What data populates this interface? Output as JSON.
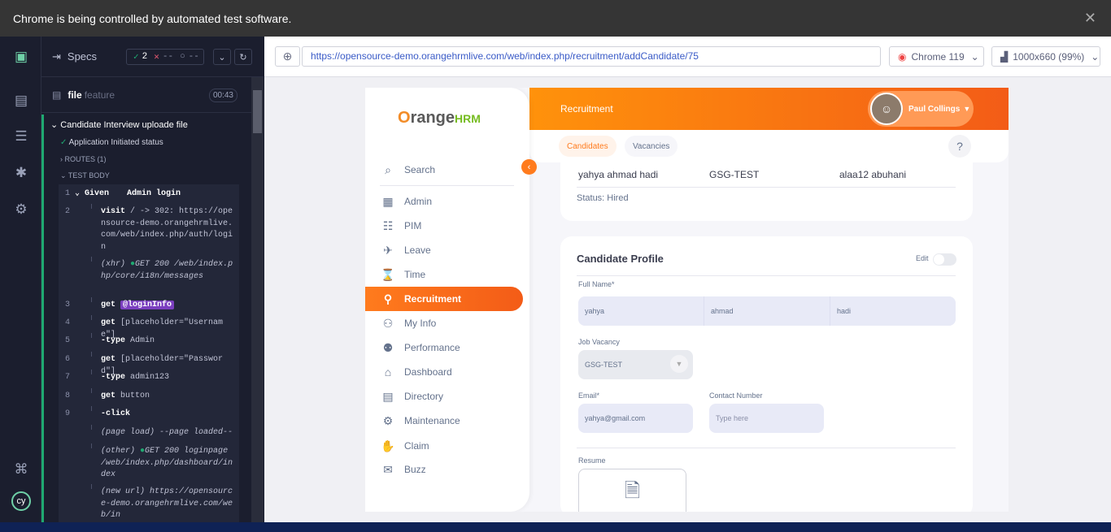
{
  "banner": {
    "text": "Chrome is being controlled by automated test software.",
    "close": "✕"
  },
  "runner": {
    "specs_label": "Specs",
    "passed": "2",
    "failed": "--",
    "pending": "--",
    "file_name": "file",
    "file_ext": "feature",
    "duration": "00:43",
    "suite": "Candidate Interview uploade file",
    "test1": "Application Initiated status",
    "routes": "ROUTES (1)",
    "test_body": "TEST BODY",
    "commands": [
      {
        "n": "1",
        "kw": "Given",
        "arg": "Admin login"
      },
      {
        "n": "2",
        "kw": "visit",
        "arg": "/ -> 302: https://opensource-demo.orangehrmlive.com/web/index.php/auth/login"
      },
      {
        "n": "",
        "kw": "(xhr)",
        "arg": "GET 200 /web/index.php/core/i18n/messages"
      },
      {
        "n": "3",
        "kw": "get",
        "arg": "@loginInfo"
      },
      {
        "n": "4",
        "kw": "get",
        "arg": "[placeholder=\"Username\"]"
      },
      {
        "n": "5",
        "kw": "-type",
        "arg": "Admin"
      },
      {
        "n": "6",
        "kw": "get",
        "arg": "[placeholder=\"Password\"]"
      },
      {
        "n": "7",
        "kw": "-type",
        "arg": "admin123"
      },
      {
        "n": "8",
        "kw": "get",
        "arg": "button"
      },
      {
        "n": "9",
        "kw": "-click",
        "arg": ""
      },
      {
        "n": "",
        "kw": "(page load)",
        "arg": "--page loaded--"
      },
      {
        "n": "",
        "kw": "(other)",
        "arg": "GET 200 loginpage /web/index.php/dashboard/index"
      },
      {
        "n": "",
        "kw": "(new url)",
        "arg": "https://opensource-demo.orangehrmlive.com/web/in"
      }
    ]
  },
  "browser": {
    "url": "https://opensource-demo.orangehrmlive.com/web/index.php/recruitment/addCandidate/75",
    "browser_name": "Chrome 119",
    "viewport": "1000x660 (99%)"
  },
  "app": {
    "logo_main": "range",
    "logo_hrm": "HRM",
    "logo_o": "O",
    "module": "Recruitment",
    "user": "Paul Collings",
    "search": "Search",
    "nav": [
      "Admin",
      "PIM",
      "Leave",
      "Time",
      "Recruitment",
      "My Info",
      "Performance",
      "Dashboard",
      "Directory",
      "Maintenance",
      "Claim",
      "Buzz"
    ],
    "tabs": [
      "Candidates",
      "Vacancies"
    ],
    "help": "?",
    "row_name": "yahya ahmad hadi",
    "row_vacancy": "GSG-TEST",
    "row_manager": "alaa12 abuhani",
    "status": "Status: Hired",
    "profile_title": "Candidate Profile",
    "edit_label": "Edit",
    "fullname_label": "Full Name*",
    "first": "yahya",
    "middle": "ahmad",
    "last": "hadi",
    "vacancy_label": "Job Vacancy",
    "vacancy_value": "GSG-TEST",
    "email_label": "Email*",
    "email_value": "yahya@gmail.com",
    "contact_label": "Contact Number",
    "contact_placeholder": "Type here",
    "resume_label": "Resume"
  }
}
